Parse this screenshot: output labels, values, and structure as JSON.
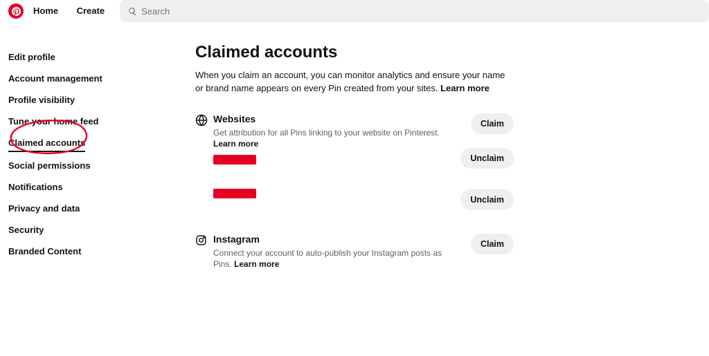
{
  "topnav": {
    "home": "Home",
    "create": "Create"
  },
  "search": {
    "placeholder": "Search"
  },
  "sidebar": {
    "items": [
      {
        "label": "Edit profile"
      },
      {
        "label": "Account management"
      },
      {
        "label": "Profile visibility"
      },
      {
        "label": "Tune your home feed"
      },
      {
        "label": "Claimed accounts",
        "active": true
      },
      {
        "label": "Social permissions"
      },
      {
        "label": "Notifications"
      },
      {
        "label": "Privacy and data"
      },
      {
        "label": "Security"
      },
      {
        "label": "Branded Content"
      }
    ]
  },
  "main": {
    "title": "Claimed accounts",
    "desc": "When you claim an account, you can monitor analytics and ensure your name or brand name appears on every Pin created from your sites.",
    "learn": "Learn more"
  },
  "sections": {
    "websites": {
      "title": "Websites",
      "text": "Get attribution for all Pins linking to your website on Pinterest.",
      "learn": "Learn more",
      "claim": "Claim",
      "unclaim1": "Unclaim",
      "unclaim2": "Unclaim"
    },
    "instagram": {
      "title": "Instagram",
      "text": "Connect your account to auto-publish your Instagram posts as Pins.",
      "learn": "Learn more",
      "claim": "Claim"
    }
  }
}
